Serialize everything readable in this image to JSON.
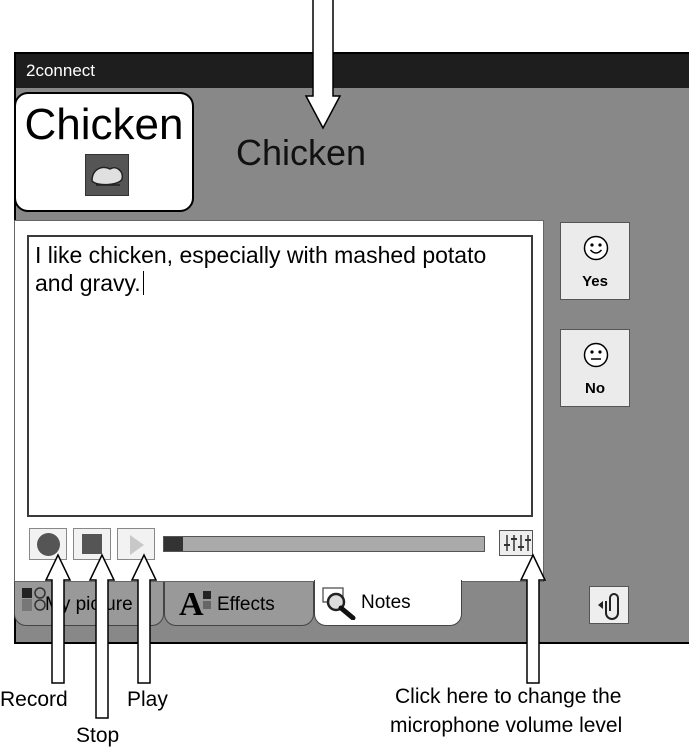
{
  "window": {
    "title": "2connect"
  },
  "card": {
    "word": "Chicken",
    "picture_icon": "chicken-picture"
  },
  "header": {
    "word": "Chicken"
  },
  "notes": {
    "text": "I like chicken, especially with mashed potato and gravy."
  },
  "audio": {
    "record_icon": "record-icon",
    "stop_icon": "stop-icon",
    "play_icon": "play-icon",
    "mic_level_fraction": 0.06,
    "mixer_icon": "mixer-icon"
  },
  "tabs": [
    {
      "label": "My picture",
      "icon": "my-picture-icon"
    },
    {
      "label": "Effects",
      "icon": "effects-icon"
    },
    {
      "label": "Notes",
      "icon": "magnifier-icon"
    }
  ],
  "side_buttons": {
    "yes": "Yes",
    "no": "No",
    "attach_icon": "paperclip-icon"
  },
  "callouts": {
    "record": "Record",
    "stop": "Stop",
    "play": "Play",
    "mic_line1": "Click here to change the",
    "mic_line2": "microphone volume level"
  }
}
